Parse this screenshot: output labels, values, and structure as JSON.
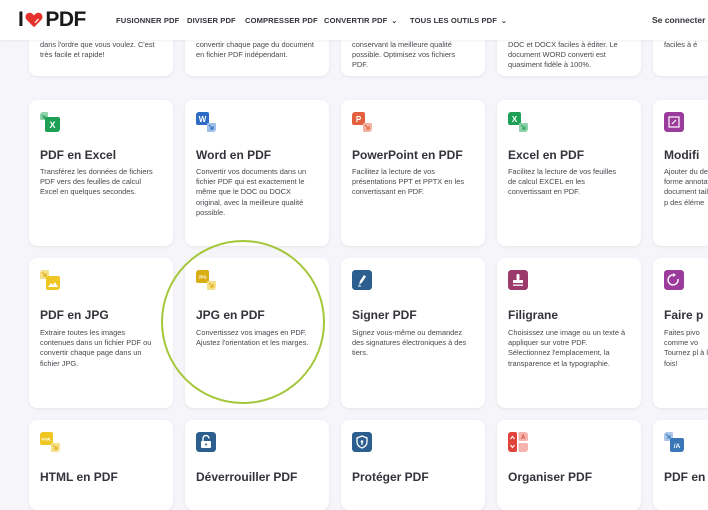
{
  "navbar": {
    "logo_left": "I",
    "logo_right": "PDF",
    "items": [
      {
        "label": "FUSIONNER PDF"
      },
      {
        "label": "DIVISER PDF"
      },
      {
        "label": "COMPRESSER PDF"
      },
      {
        "label": "CONVERTIR PDF",
        "chevron": "⌄"
      },
      {
        "label": "TOUS LES OUTILS PDF",
        "chevron": "⌄"
      }
    ],
    "login": "Se connecter"
  },
  "top_row": [
    {
      "desc": "dans l'ordre que vous voulez. C'est très facile et rapide!"
    },
    {
      "desc": "convertir chaque page du document en fichier PDF indépendant."
    },
    {
      "desc": "conservant la meilleure qualité possible. Optimisez vos fichiers PDF."
    },
    {
      "desc": "DOC et DOCX faciles à éditer. Le document WORD converti est quasiment fidèle à 100%."
    },
    {
      "desc": "faciles à é"
    }
  ],
  "tools": [
    {
      "title": "PDF en Excel",
      "desc": "Transférez les données de fichiers PDF vers des feuilles de calcul Excel en quelques secondes.",
      "icon": "excel-icon",
      "icon_text": "X",
      "color": "#1d9f55"
    },
    {
      "title": "Word en PDF",
      "desc": "Convertir vos documents dans un fichier PDF qui est exactement le même que le DOC ou DOCX original, avec la meilleure qualité possible.",
      "icon": "word-icon",
      "icon_text": "W",
      "color": "#2d6bc4"
    },
    {
      "title": "PowerPoint en PDF",
      "desc": "Facilitez la lecture de vos présentations PPT et PPTX en les convertissant en PDF.",
      "icon": "powerpoint-icon",
      "icon_text": "P",
      "color": "#e5603f"
    },
    {
      "title": "Excel en PDF",
      "desc": "Facilitez la lecture de vos feuilles de calcul EXCEL en les convertissant en PDF.",
      "icon": "excel-icon",
      "icon_text": "X",
      "color": "#1d9f55"
    },
    {
      "title": "Modifi",
      "desc": "Ajouter du des forme annotatio document taille, la p des éléme",
      "icon": "edit-icon",
      "icon_text": "",
      "color": "#9b3b9b"
    },
    {
      "title": "PDF en JPG",
      "desc": "Extraire toutes les images contenues dans un fichier PDF ou convertir chaque page dans un fichier JPG.",
      "icon": "image-icon",
      "icon_text": "",
      "color": "#efc725"
    },
    {
      "title": "JPG en PDF",
      "desc": "Convertissez vos images en PDF. Ajustez l'orientation et les marges.",
      "icon": "jpg-icon",
      "icon_text": "JPG",
      "color": "#d9ad14"
    },
    {
      "title": "Signer PDF",
      "desc": "Signez vous-même ou demandez des signatures électroniques à des tiers.",
      "icon": "pen-icon",
      "icon_text": "",
      "color": "#2c5f8f"
    },
    {
      "title": "Filigrane",
      "desc": "Choisissez une image ou un texte à appliquer sur votre PDF. Sélectionnez l'emplacement, la transparence et la typographie.",
      "icon": "stamp-icon",
      "icon_text": "",
      "color": "#9b3b6c"
    },
    {
      "title": "Faire p",
      "desc": "Faites pivo comme vo Tournez pl à la fois!",
      "icon": "rotate-icon",
      "icon_text": "",
      "color": "#9b3b9b"
    },
    {
      "title": "HTML en PDF",
      "desc": "",
      "icon": "html-icon",
      "icon_text": "HTML",
      "color": "#efc725"
    },
    {
      "title": "Déverrouiller PDF",
      "desc": "",
      "icon": "unlock-icon",
      "icon_text": "",
      "color": "#2c5f8f"
    },
    {
      "title": "Protéger PDF",
      "desc": "",
      "icon": "shield-icon",
      "icon_text": "",
      "color": "#2c5f8f"
    },
    {
      "title": "Organiser PDF",
      "desc": "",
      "icon": "organize-icon",
      "icon_text": "A",
      "color": "#e0433a"
    },
    {
      "title": "PDF en",
      "desc": "",
      "icon": "translate-icon",
      "icon_text": "/A",
      "color": "#3a76b8"
    }
  ],
  "colors": {
    "brand_red": "#e5322d",
    "highlight_circle": "#a4c639"
  }
}
